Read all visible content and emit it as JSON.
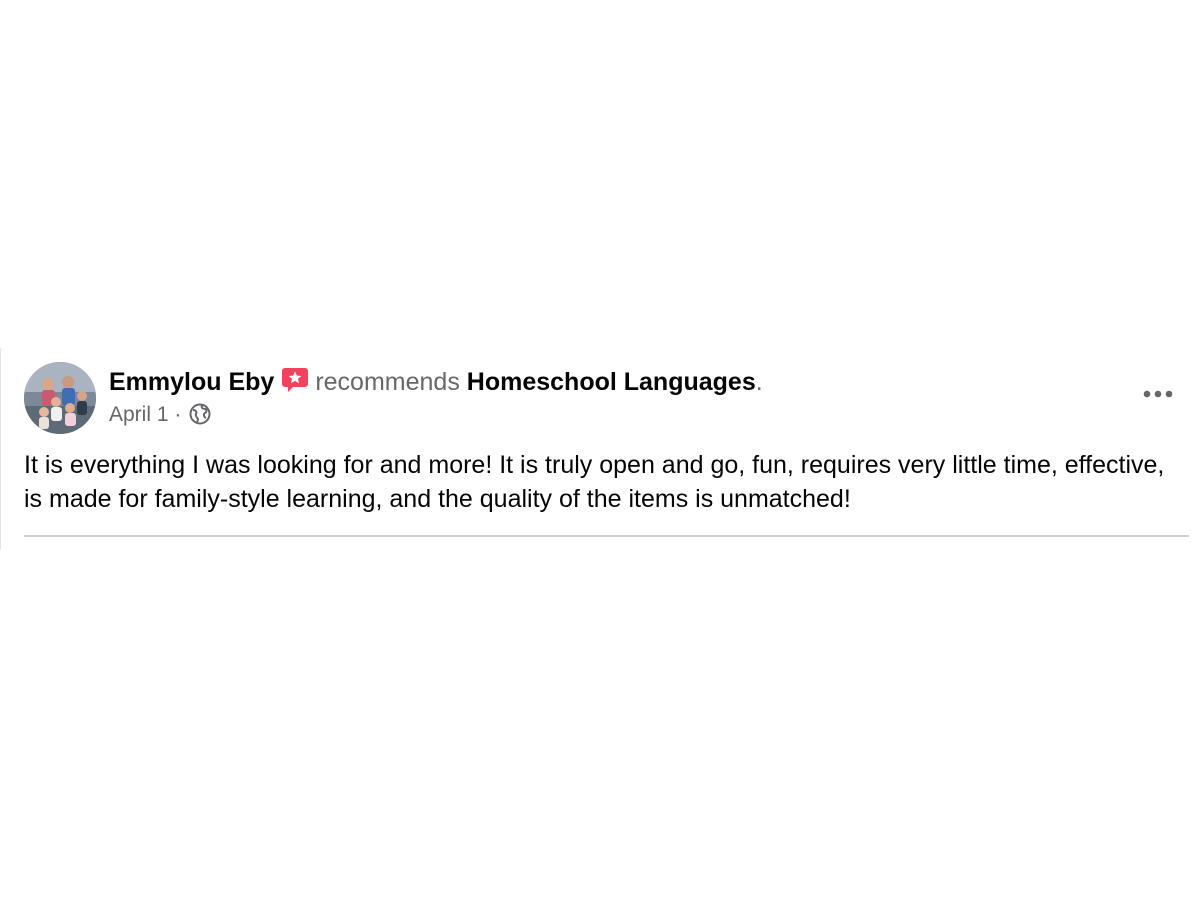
{
  "post": {
    "author": "Emmylou Eby",
    "action": "recommends",
    "page": "Homeschool Languages",
    "period": ".",
    "date": "April 1",
    "separator": "·",
    "privacy_icon": "globe-icon",
    "recommend_icon": "recommendation-star-icon",
    "menu_icon": "more-options-icon",
    "text": "It is everything I was looking for and more! It is truly open and go, fun, requires very little time, effective, is made for family-style learning, and the quality of the items is unmatched!"
  },
  "colors": {
    "primary_text": "#050505",
    "secondary_text": "#65676b",
    "recommend_accent": "#f3425f",
    "divider": "#ced0d4"
  }
}
